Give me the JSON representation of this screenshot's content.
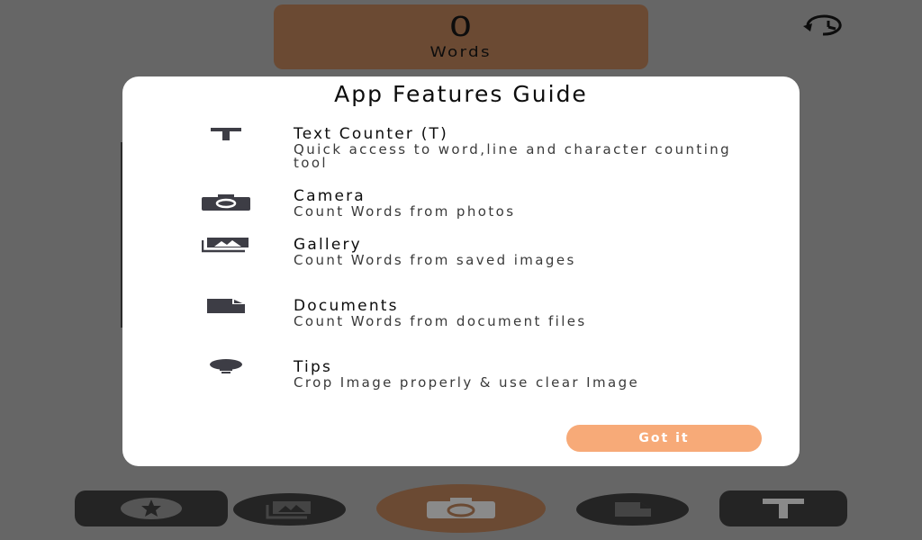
{
  "counter": {
    "value": "0",
    "label": "Words"
  },
  "dialog": {
    "title": "App Features Guide",
    "features": [
      {
        "icon": "text-icon",
        "title": "Text Counter (T)",
        "description": "Quick access to word,line and character counting tool"
      },
      {
        "icon": "camera-icon",
        "title": "Camera",
        "description": "Count Words from photos"
      },
      {
        "icon": "gallery-icon",
        "title": "Gallery",
        "description": "Count Words from saved images"
      },
      {
        "icon": "document-icon",
        "title": "Documents",
        "description": "Count Words from document files"
      },
      {
        "icon": "lightbulb-icon",
        "title": "Tips",
        "description": "Crop Image properly & use clear Image"
      }
    ],
    "button_label": "Got it"
  },
  "colors": {
    "overlay": "#666666",
    "accent_brown": "#6b4a33",
    "button_orange": "#f7aa78",
    "icon_dark": "#3d3d45"
  },
  "bottom_bar": [
    "star-icon",
    "gallery-icon",
    "camera-icon",
    "document-icon",
    "text-icon"
  ]
}
